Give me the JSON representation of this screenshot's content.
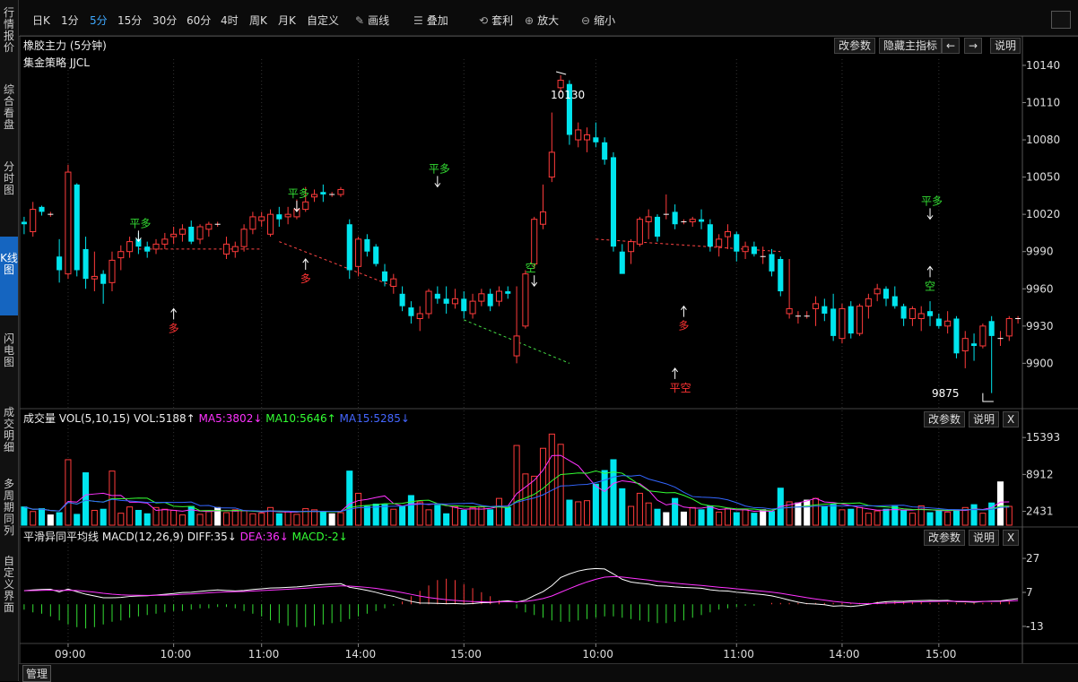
{
  "left_tabs": [
    "行情报价",
    "综合看盘",
    "分时图",
    "K线图",
    "闪电图",
    "成交明细",
    "多周期同列",
    "自定义界面"
  ],
  "toolbar": {
    "periods": [
      "日K",
      "1分",
      "5分",
      "15分",
      "30分",
      "60分",
      "4时",
      "周K",
      "月K",
      "自定义"
    ],
    "selected": "5分",
    "tools": [
      {
        "icon": "pen-icon",
        "label": "画线"
      },
      {
        "icon": "stack-icon",
        "label": "叠加"
      },
      {
        "icon": "arbitrage-icon",
        "label": "套利"
      },
      {
        "icon": "zoom-in-icon",
        "label": "放大"
      },
      {
        "icon": "zoom-out-icon",
        "label": "缩小"
      }
    ]
  },
  "main": {
    "title": "橡胶主力 (5分钟)",
    "strategy": "集金策略 JJCL",
    "buttons": [
      "改参数",
      "隐藏主指标",
      "←",
      "→",
      "说明"
    ],
    "high_label": "10130",
    "low_label": "9875"
  },
  "vol": {
    "title": "成交量 VOL(5,10,15)",
    "vol": "VOL:5188↑",
    "ma5": "MA5:3802↓",
    "ma10": "MA10:5646↑",
    "ma15": "MA15:5285↓",
    "buttons": [
      "改参数",
      "说明",
      "X"
    ]
  },
  "macd": {
    "title": "平滑异同平均线 MACD(12,26,9)",
    "diff": "DIFF:35↓",
    "dea": "DEA:36↓",
    "macd": "MACD:-2↓",
    "buttons": [
      "改参数",
      "说明",
      "X"
    ]
  },
  "bottom": {
    "manage": "管理"
  },
  "colors": {
    "up": "#ff3b3b",
    "down": "#00e5ee",
    "ma5": "#ff33ff",
    "ma10": "#33ff33",
    "ma15": "#3366ff",
    "signal_green": "#33dd33",
    "signal_red": "#ff3333"
  },
  "chart_data": {
    "type": "candlestick",
    "price_ticks": [
      10140,
      10110,
      10080,
      10050,
      10020,
      9990,
      9960,
      9930,
      9900
    ],
    "vol_ticks": [
      15393,
      8912,
      2431
    ],
    "macd_ticks": [
      27,
      7,
      -13
    ],
    "time_ticks": [
      "09:00",
      "10:00",
      "11:00",
      "14:00",
      "15:00",
      "10:00",
      "11:00",
      "14:00",
      "15:00"
    ],
    "candles": [
      [
        10014,
        10018,
        10004,
        10012
      ],
      [
        10006,
        10030,
        10002,
        10024
      ],
      [
        10026,
        10027,
        10019,
        10022
      ],
      [
        10020,
        10022,
        10018,
        10020
      ],
      [
        9986,
        10000,
        9965,
        9975
      ],
      [
        9972,
        10060,
        9968,
        10054
      ],
      [
        10044,
        10045,
        9970,
        9975
      ],
      [
        9992,
        10002,
        9960,
        9968
      ],
      [
        9968,
        9990,
        9958,
        9970
      ],
      [
        9972,
        9975,
        9948,
        9964
      ],
      [
        9965,
        9990,
        9958,
        9983
      ],
      [
        9985,
        9995,
        9975,
        9990
      ],
      [
        9990,
        10002,
        9985,
        9998
      ],
      [
        10000,
        10005,
        9988,
        9994
      ],
      [
        9994,
        9998,
        9985,
        9990
      ],
      [
        9992,
        10000,
        9988,
        9996
      ],
      [
        9996,
        10005,
        9992,
        10000
      ],
      [
        10002,
        10010,
        9996,
        10004
      ],
      [
        10004,
        10012,
        9998,
        10008
      ],
      [
        10010,
        10015,
        9996,
        9998
      ],
      [
        10000,
        10012,
        9996,
        10010
      ],
      [
        10008,
        10014,
        10002,
        10012
      ],
      [
        10012,
        10014,
        10010,
        10012
      ],
      [
        9988,
        10002,
        9984,
        9996
      ],
      [
        9990,
        9998,
        9985,
        9994
      ],
      [
        9994,
        10012,
        9990,
        10008
      ],
      [
        10008,
        10022,
        10004,
        10018
      ],
      [
        10015,
        10022,
        10010,
        10018
      ],
      [
        10004,
        10024,
        10002,
        10020
      ],
      [
        10020,
        10026,
        10010,
        10016
      ],
      [
        10018,
        10026,
        10012,
        10020
      ],
      [
        10018,
        10032,
        10016,
        10024
      ],
      [
        10024,
        10042,
        10022,
        10030
      ],
      [
        10034,
        10040,
        10030,
        10036
      ],
      [
        10038,
        10044,
        10030,
        10036
      ],
      [
        10036,
        10038,
        10034,
        10036
      ],
      [
        10036,
        10042,
        10034,
        10040
      ],
      [
        10012,
        10016,
        9968,
        9975
      ],
      [
        9978,
        10002,
        9970,
        10000
      ],
      [
        10000,
        10004,
        9986,
        9990
      ],
      [
        9994,
        9996,
        9978,
        9980
      ],
      [
        9974,
        9980,
        9962,
        9966
      ],
      [
        9962,
        9972,
        9956,
        9968
      ],
      [
        9956,
        9962,
        9942,
        9946
      ],
      [
        9945,
        9950,
        9932,
        9938
      ],
      [
        9936,
        9946,
        9926,
        9940
      ],
      [
        9940,
        9960,
        9936,
        9958
      ],
      [
        9956,
        9962,
        9948,
        9952
      ],
      [
        9952,
        9962,
        9940,
        9948
      ],
      [
        9948,
        9960,
        9944,
        9952
      ],
      [
        9952,
        9958,
        9936,
        9942
      ],
      [
        9940,
        9956,
        9936,
        9950
      ],
      [
        9950,
        9960,
        9946,
        9956
      ],
      [
        9956,
        9960,
        9942,
        9946
      ],
      [
        9950,
        9962,
        9946,
        9958
      ],
      [
        9958,
        9962,
        9952,
        9956
      ],
      [
        9906,
        9962,
        9900,
        9922
      ],
      [
        9930,
        9975,
        9928,
        9972
      ],
      [
        9980,
        10018,
        9976,
        10016
      ],
      [
        10012,
        10044,
        10008,
        10022
      ],
      [
        10050,
        10102,
        10046,
        10070
      ],
      [
        10122,
        10132,
        10118,
        10128
      ],
      [
        10125,
        10128,
        10076,
        10084
      ],
      [
        10080,
        10094,
        10074,
        10088
      ],
      [
        10080,
        10090,
        10070,
        10084
      ],
      [
        10082,
        10094,
        10074,
        10078
      ],
      [
        10078,
        10082,
        10060,
        10064
      ],
      [
        10066,
        10070,
        9990,
        9994
      ],
      [
        9990,
        9996,
        9974,
        9972
      ],
      [
        9990,
        10000,
        9980,
        9998
      ],
      [
        9996,
        10018,
        9994,
        10016
      ],
      [
        10014,
        10024,
        10000,
        10018
      ],
      [
        10018,
        10020,
        9998,
        10002
      ],
      [
        10020,
        10036,
        10016,
        10020
      ],
      [
        10022,
        10028,
        10008,
        10012
      ],
      [
        10014,
        10016,
        10012,
        10014
      ],
      [
        10014,
        10018,
        10010,
        10016
      ],
      [
        10016,
        10024,
        10008,
        10014
      ],
      [
        10012,
        10016,
        9990,
        9994
      ],
      [
        9994,
        10004,
        9986,
        10000
      ],
      [
        10002,
        10012,
        9992,
        10006
      ],
      [
        10004,
        10006,
        9982,
        9990
      ],
      [
        9990,
        9998,
        9984,
        9994
      ],
      [
        9994,
        9998,
        9986,
        9988
      ],
      [
        9986,
        9994,
        9980,
        9986
      ],
      [
        9988,
        9992,
        9970,
        9974
      ],
      [
        9984,
        9986,
        9954,
        9958
      ],
      [
        9940,
        9984,
        9936,
        9944
      ],
      [
        9938,
        9942,
        9932,
        9938
      ],
      [
        9938,
        9942,
        9936,
        9938
      ],
      [
        9944,
        9954,
        9930,
        9948
      ],
      [
        9946,
        9952,
        9934,
        9940
      ],
      [
        9944,
        9956,
        9918,
        9922
      ],
      [
        9920,
        9948,
        9916,
        9944
      ],
      [
        9946,
        9950,
        9920,
        9924
      ],
      [
        9924,
        9948,
        9922,
        9946
      ],
      [
        9946,
        9956,
        9936,
        9952
      ],
      [
        9956,
        9964,
        9950,
        9960
      ],
      [
        9960,
        9962,
        9946,
        9952
      ],
      [
        9954,
        9962,
        9944,
        9946
      ],
      [
        9946,
        9948,
        9930,
        9936
      ],
      [
        9936,
        9946,
        9930,
        9944
      ],
      [
        9936,
        9946,
        9926,
        9940
      ],
      [
        9942,
        9950,
        9930,
        9938
      ],
      [
        9936,
        9940,
        9928,
        9930
      ],
      [
        9930,
        9942,
        9924,
        9934
      ],
      [
        9936,
        9938,
        9904,
        9908
      ],
      [
        9910,
        9926,
        9896,
        9920
      ],
      [
        9916,
        9924,
        9902,
        9914
      ],
      [
        9914,
        9932,
        9912,
        9930
      ],
      [
        9934,
        9938,
        9876,
        9922
      ],
      [
        9920,
        9926,
        9914,
        9920
      ],
      [
        9922,
        9938,
        9918,
        9936
      ],
      [
        9936,
        9938,
        9932,
        9936
      ]
    ],
    "volumes": [
      3200,
      2400,
      2900,
      1800,
      2200,
      11500,
      1900,
      9200,
      2600,
      2800,
      9500,
      2100,
      3200,
      2600,
      2000,
      3100,
      2800,
      2600,
      1800,
      3300,
      1900,
      2400,
      3100,
      2200,
      2700,
      2500,
      2000,
      2100,
      3100,
      2000,
      2400,
      1900,
      2900,
      2700,
      2300,
      2000,
      2200,
      9500,
      5600,
      3300,
      3700,
      3600,
      2800,
      3300,
      5200,
      4100,
      2700,
      3500,
      2000,
      3200,
      2600,
      3100,
      3200,
      2700,
      4700,
      3100,
      14000,
      9000,
      8600,
      13500,
      16000,
      14200,
      4400,
      4100,
      4300,
      7200,
      9600,
      11500,
      6400,
      3300,
      5600,
      3900,
      2800,
      2200,
      4700,
      2300,
      3100,
      2700,
      3400,
      2300,
      2900,
      2200,
      2700,
      2100,
      2700,
      2400,
      6500,
      4100,
      3900,
      4400,
      4700,
      3300,
      3600,
      2700,
      2800,
      3100,
      2100,
      2500,
      2800,
      3300,
      2600,
      2100,
      3400,
      2200,
      2600,
      2300,
      2700,
      3100,
      3600,
      2100,
      3900,
      7600,
      3300
    ],
    "macd_hist": [
      -4,
      -6,
      -7,
      -9,
      -12,
      -15,
      -17,
      -18,
      -17,
      -15,
      -13,
      -12,
      -10,
      -9,
      -8,
      -7,
      -6,
      -5,
      -5,
      -4,
      -3,
      -3,
      -2,
      -2,
      -3,
      -5,
      -7,
      -9,
      -12,
      -14,
      -16,
      -17,
      -17,
      -16,
      -15,
      -14,
      -13,
      -11,
      -9,
      -7,
      -5,
      -3,
      -1,
      2,
      6,
      10,
      14,
      18,
      19,
      18,
      15,
      12,
      9,
      6,
      3,
      0,
      -3,
      -6,
      -8,
      -10,
      -12,
      -13,
      -13,
      -12,
      -11,
      -10,
      -9,
      -9,
      -10,
      -11,
      -12,
      -13,
      -14,
      -14,
      -13,
      -12,
      -10,
      -8,
      -6,
      -4,
      -3,
      -2,
      -1,
      -1,
      0,
      1,
      1,
      1,
      1,
      1,
      1,
      1,
      1,
      1,
      1,
      1,
      1,
      2,
      2,
      2,
      2,
      2,
      2,
      1,
      1,
      1,
      1,
      1,
      1,
      1,
      1,
      2,
      2
    ],
    "signals": [
      {
        "label": "平多",
        "type": "close-long"
      },
      {
        "label": "多",
        "type": "long"
      },
      {
        "label": "平多",
        "type": "close-long"
      },
      {
        "label": "多",
        "type": "long"
      },
      {
        "label": "平多",
        "type": "close-long"
      },
      {
        "label": "空",
        "type": "short"
      },
      {
        "label": "平空",
        "type": "close-short"
      },
      {
        "label": "多",
        "type": "long"
      },
      {
        "label": "平多",
        "type": "close-long"
      },
      {
        "label": "空",
        "type": "short"
      }
    ]
  }
}
